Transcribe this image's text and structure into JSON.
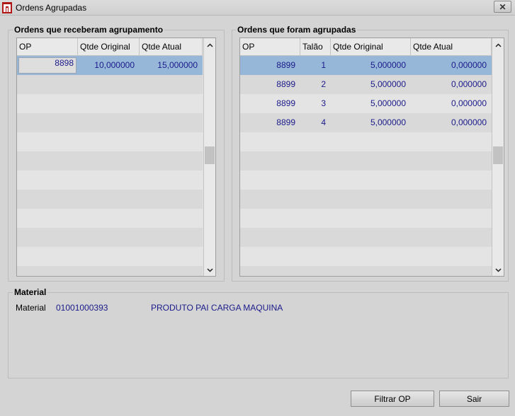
{
  "window": {
    "title": "Ordens Agrupadas",
    "close_label": "✕"
  },
  "left_group": {
    "title": "Ordens que receberam agrupamento",
    "columns": [
      "OP",
      "Qtde Original",
      "Qtde Atual"
    ],
    "rows": [
      {
        "op": "8898",
        "qtde_original": "10,000000",
        "qtde_atual": "15,000000"
      }
    ]
  },
  "right_group": {
    "title": "Ordens que foram agrupadas",
    "columns": [
      "OP",
      "Talão",
      "Qtde Original",
      "Qtde Atual"
    ],
    "rows": [
      {
        "op": "8899",
        "talao": "1",
        "qtde_original": "5,000000",
        "qtde_atual": "0,000000"
      },
      {
        "op": "8899",
        "talao": "2",
        "qtde_original": "5,000000",
        "qtde_atual": "0,000000"
      },
      {
        "op": "8899",
        "talao": "3",
        "qtde_original": "5,000000",
        "qtde_atual": "0,000000"
      },
      {
        "op": "8899",
        "talao": "4",
        "qtde_original": "5,000000",
        "qtde_atual": "0,000000"
      }
    ]
  },
  "material": {
    "group_title": "Material",
    "label": "Material",
    "code": "01001000393",
    "description": "PRODUTO PAI CARGA MAQUINA"
  },
  "buttons": {
    "filtrar_op": "Filtrar OP",
    "sair": "Sair"
  },
  "colors": {
    "selection": "#97b7d9",
    "value_text": "#1a1a8a",
    "window_bg": "#d4d4d4"
  }
}
